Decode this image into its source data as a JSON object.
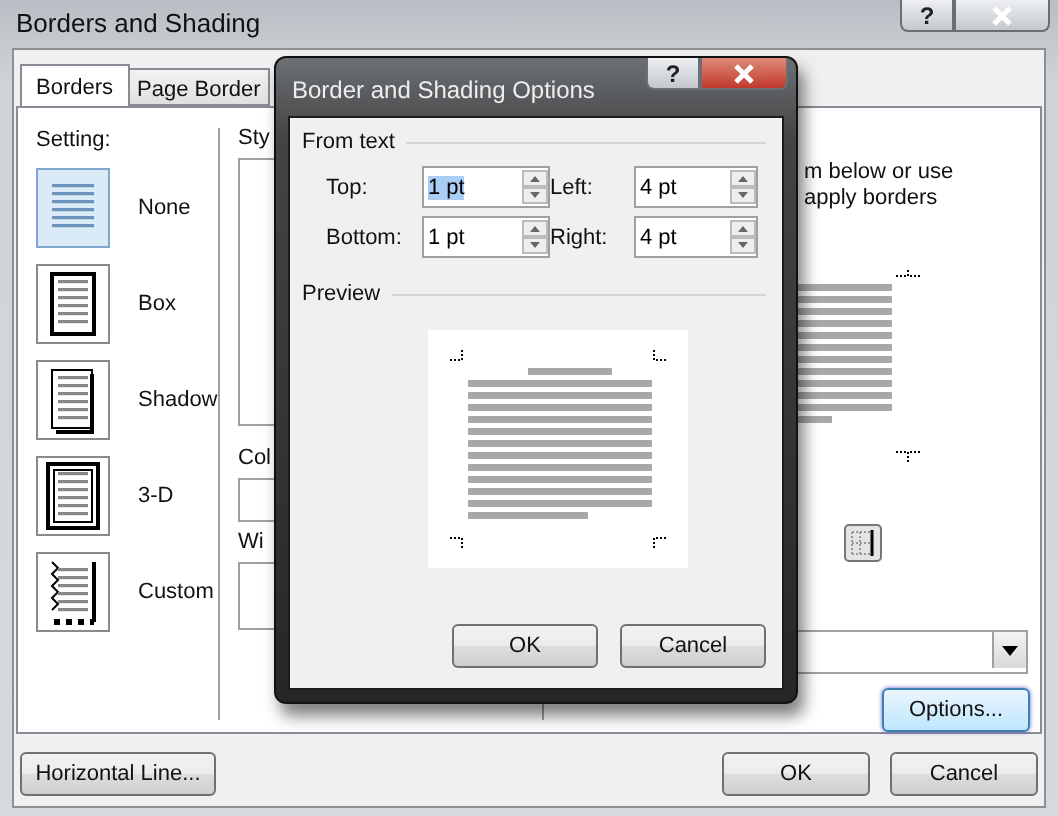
{
  "window": {
    "title": "Borders and Shading",
    "help": "?"
  },
  "tabs": [
    {
      "label": "Borders",
      "selected": true
    },
    {
      "label": "Page Border",
      "selected": false
    }
  ],
  "setting": {
    "label": "Setting:",
    "items": [
      {
        "label": "None",
        "kind": "none",
        "selected": true
      },
      {
        "label": "Box",
        "kind": "box",
        "selected": false
      },
      {
        "label": "Shadow",
        "kind": "shadow",
        "selected": false
      },
      {
        "label": "3-D",
        "kind": "threed",
        "selected": false
      },
      {
        "label": "Custom",
        "kind": "custom",
        "selected": false
      }
    ]
  },
  "style": {
    "label": "Sty"
  },
  "color": {
    "label": "Col"
  },
  "width": {
    "label": "Wi"
  },
  "preview": {
    "lines": [
      "m below or use",
      "apply borders"
    ]
  },
  "options_button": {
    "label": "Options...",
    "focused": true
  },
  "horizontal_line_button": "Horizontal Line...",
  "buttons": [
    "OK",
    "Cancel"
  ],
  "dialog": {
    "title": "Border and Shading Options",
    "help": "?",
    "section": "From text",
    "fields": [
      {
        "label": "Top:",
        "value": "1 pt",
        "selected": true
      },
      {
        "label": "Left:",
        "value": "4 pt",
        "selected": false
      },
      {
        "label": "Bottom:",
        "value": "1 pt",
        "selected": false
      },
      {
        "label": "Right:",
        "value": "4 pt",
        "selected": false
      }
    ],
    "preview_label": "Preview",
    "buttons": [
      "OK",
      "Cancel"
    ]
  }
}
